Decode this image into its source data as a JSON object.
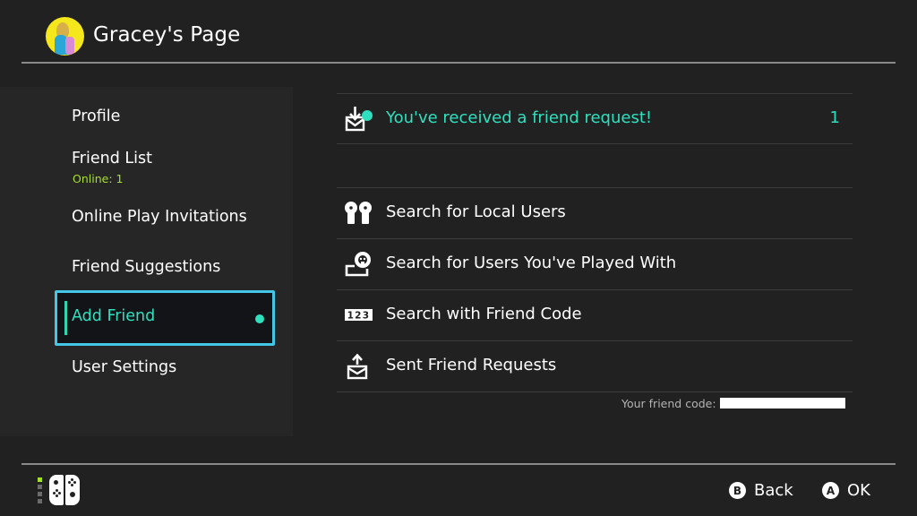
{
  "header": {
    "title": "Gracey's Page",
    "avatar": "user-avatar"
  },
  "sidebar": {
    "items": [
      {
        "label": "Profile"
      },
      {
        "label": "Friend List",
        "sublabel": "Online: 1"
      },
      {
        "label": "Online Play Invitations"
      },
      {
        "label": "Friend Suggestions"
      },
      {
        "label": "Add Friend",
        "selected": true,
        "badge": "new-dot"
      },
      {
        "label": "User Settings"
      }
    ]
  },
  "main": {
    "notice": {
      "icon": "inbox-download-icon",
      "label": "You've received a friend request!",
      "count": "1"
    },
    "options": [
      {
        "icon": "local-users-icon",
        "label": "Search for Local Users"
      },
      {
        "icon": "played-with-icon",
        "label": "Search for Users You've Played With"
      },
      {
        "icon": "friend-code-123-icon",
        "label": "Search with Friend Code",
        "icon_text": "123"
      },
      {
        "icon": "outbox-upload-icon",
        "label": "Sent Friend Requests"
      }
    ],
    "friend_code_label": "Your friend code:"
  },
  "footer": {
    "controller": "joycon-pair-icon",
    "player_led": 1,
    "back": {
      "glyph": "B",
      "label": "Back"
    },
    "ok": {
      "glyph": "A",
      "label": "OK"
    }
  },
  "colors": {
    "background": "#212121",
    "sidebar": "#262626",
    "accent": "#2fe0be",
    "focus_border": "#44c7e6",
    "online_green": "#a5e02a"
  }
}
